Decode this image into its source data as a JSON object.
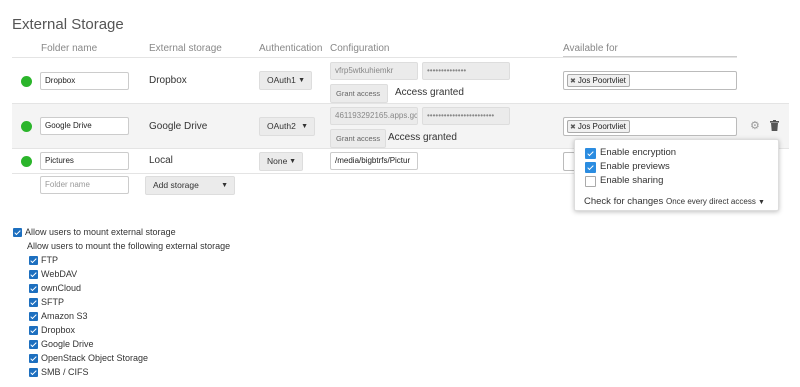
{
  "section_title": "External Storage",
  "headers": {
    "folder_name": "Folder name",
    "external_storage": "External storage",
    "authentication": "Authentication",
    "configuration": "Configuration",
    "available_for": "Available for"
  },
  "rows": [
    {
      "status": "ok",
      "folder": "Dropbox",
      "storage": "Dropbox",
      "auth": "OAuth1",
      "config1": "vfrp5wtkuhiemkr",
      "config2": "••••••••••••••",
      "grant_label": "Grant access",
      "grant_status": "Access granted",
      "available_for": "Jos Poortvliet"
    },
    {
      "status": "ok",
      "folder": "Google Drive",
      "storage": "Google Drive",
      "auth": "OAuth2",
      "config1": "461193292165.apps.gc",
      "config2": "••••••••••••••••••••••••",
      "grant_label": "Grant access",
      "grant_status": "Access granted",
      "available_for": "Jos Poortvliet"
    },
    {
      "status": "ok",
      "folder": "Pictures",
      "storage": "Local",
      "auth": "None",
      "config1": "/media/bigbtrfs/Pictur"
    }
  ],
  "new_row": {
    "folder_placeholder": "Folder name",
    "add_storage_label": "Add storage"
  },
  "popup": {
    "options": [
      {
        "label": "Enable encryption",
        "checked": true
      },
      {
        "label": "Enable previews",
        "checked": true
      },
      {
        "label": "Enable sharing",
        "checked": false
      }
    ],
    "check_label": "Check for changes",
    "check_value": "Once every direct access"
  },
  "allow_mount_label": "Allow users to mount external storage",
  "allow_following_label": "Allow users to mount the following external storage",
  "backends": [
    "FTP",
    "WebDAV",
    "ownCloud",
    "SFTP",
    "Amazon S3",
    "Dropbox",
    "Google Drive",
    "OpenStack Object Storage",
    "SMB / CIFS"
  ],
  "colors": {
    "status_ok": "#2bb52b",
    "checkbox": "#1d6fbf"
  },
  "icons": {
    "settings": "gear-icon",
    "delete": "trash-icon",
    "tag_remove": "close-icon",
    "dropdown": "caret-down-icon"
  }
}
